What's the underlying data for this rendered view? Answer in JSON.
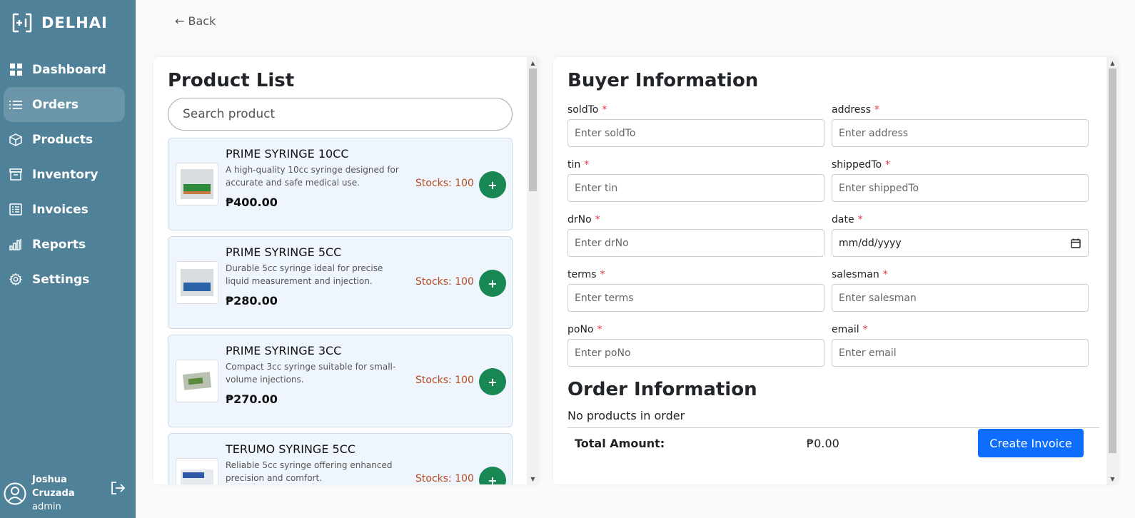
{
  "brand": {
    "name": "DELHAI"
  },
  "nav": [
    {
      "label": "Dashboard",
      "icon": "dashboard-icon",
      "active": false
    },
    {
      "label": "Orders",
      "icon": "list-icon",
      "active": true
    },
    {
      "label": "Products",
      "icon": "box-icon",
      "active": false
    },
    {
      "label": "Inventory",
      "icon": "archive-icon",
      "active": false
    },
    {
      "label": "Invoices",
      "icon": "receipt-icon",
      "active": false
    },
    {
      "label": "Reports",
      "icon": "bar-chart-icon",
      "active": false
    },
    {
      "label": "Settings",
      "icon": "gear-icon",
      "active": false
    }
  ],
  "user": {
    "name": "Joshua Cruzada",
    "role": "admin"
  },
  "back_label": "← Back",
  "product_list": {
    "title": "Product List",
    "search_placeholder": "Search product",
    "items": [
      {
        "name": "PRIME SYRINGE 10CC",
        "description": "A high-quality 10cc syringe designed for accurate and safe medical use.",
        "price": "₱400.00",
        "stock": "Stocks: 100",
        "add_label": "+"
      },
      {
        "name": "PRIME SYRINGE 5CC",
        "description": "Durable 5cc syringe ideal for precise liquid measurement and injection.",
        "price": "₱280.00",
        "stock": "Stocks: 100",
        "add_label": "+"
      },
      {
        "name": "PRIME SYRINGE 3CC",
        "description": "Compact 3cc syringe suitable for small-volume injections.",
        "price": "₱270.00",
        "stock": "Stocks: 100",
        "add_label": "+"
      },
      {
        "name": "TERUMO SYRINGE 5CC",
        "description": "Reliable 5cc syringe offering enhanced precision and comfort.",
        "price": "",
        "stock": "Stocks: 100",
        "add_label": "+"
      }
    ]
  },
  "buyer": {
    "title": "Buyer Information",
    "fields": [
      {
        "label": "soldTo",
        "placeholder": "Enter soldTo"
      },
      {
        "label": "address",
        "placeholder": "Enter address"
      },
      {
        "label": "tin",
        "placeholder": "Enter tin"
      },
      {
        "label": "shippedTo",
        "placeholder": "Enter shippedTo"
      },
      {
        "label": "drNo",
        "placeholder": "Enter drNo"
      },
      {
        "label": "date",
        "value": "mm/dd/yyyy"
      },
      {
        "label": "terms",
        "placeholder": "Enter terms"
      },
      {
        "label": "salesman",
        "placeholder": "Enter salesman"
      },
      {
        "label": "poNo",
        "placeholder": "Enter poNo"
      },
      {
        "label": "email",
        "placeholder": "Enter email"
      }
    ],
    "required_mark": "*"
  },
  "order": {
    "title": "Order Information",
    "empty_text": "No products in order",
    "total_label": "Total Amount:",
    "total_value": "₱0.00",
    "create_label": "Create Invoice"
  },
  "colors": {
    "sidebar": "#4f8199",
    "accent_green": "#198754",
    "primary_blue": "#0d6efd",
    "stock_text": "#b64a1d",
    "required": "#dc3545"
  }
}
